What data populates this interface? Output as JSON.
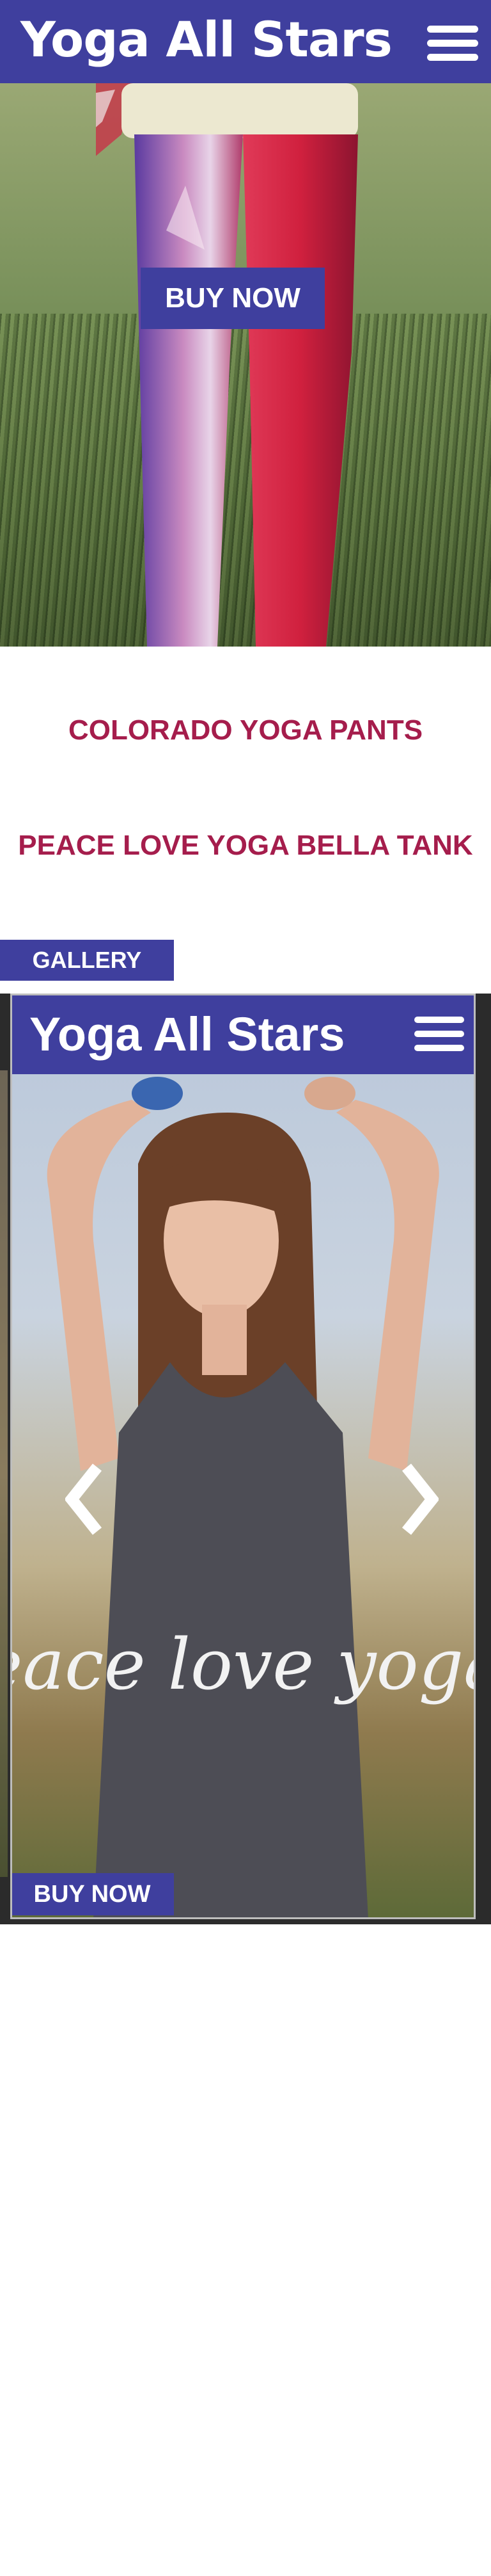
{
  "header": {
    "brand": "Yoga All Stars",
    "menu_icon": "hamburger-menu-icon"
  },
  "hero": {
    "image": "colorado-flag-yoga-leggings-photo",
    "buy_now_label": "BUY NOW"
  },
  "products": [
    {
      "label": "COLORADO YOGA PANTS"
    },
    {
      "label": "PEACE LOVE YOGA BELLA TANK"
    }
  ],
  "gallery": {
    "button_label": "GALLERY",
    "slide": {
      "brand": "Yoga All Stars",
      "menu_icon": "hamburger-menu-icon",
      "image": "peace-love-yoga-tank-photo",
      "shirt_text": "Peace love yoga",
      "buy_now_label": "BUY NOW"
    },
    "prev_icon": "chevron-left-icon",
    "next_icon": "chevron-right-icon"
  },
  "colors": {
    "brand_blue": "#3f3f9e",
    "product_link": "#a51d4c",
    "white": "#ffffff",
    "gallery_bg": "#2b2b2b"
  }
}
